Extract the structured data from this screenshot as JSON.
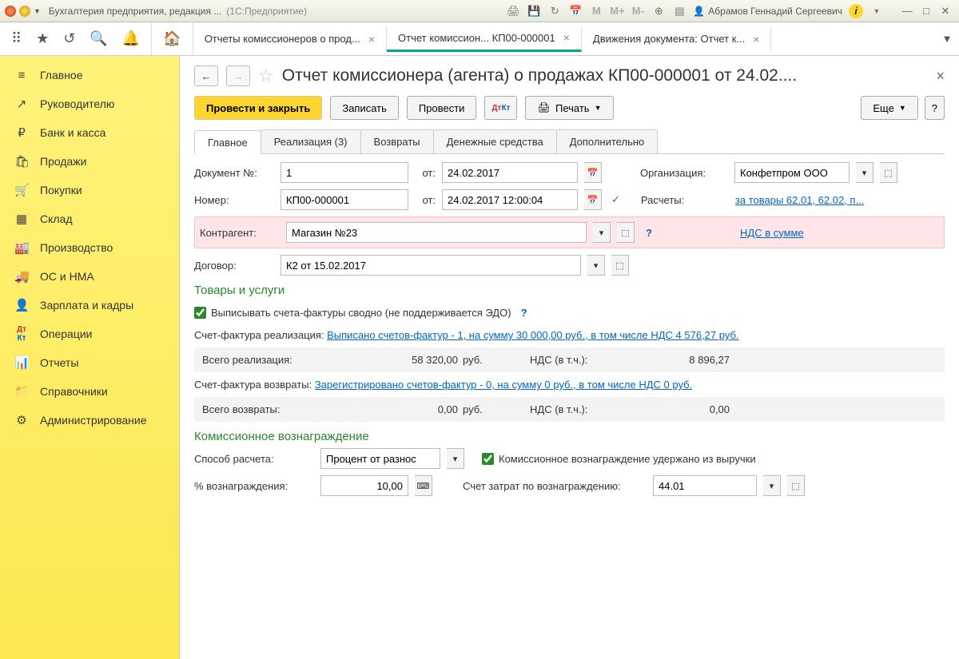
{
  "titlebar": {
    "title": "Бухгалтерия предприятия, редакция ...",
    "subtitle": "(1С:Предприятие)",
    "user": "Абрамов Геннадий Сергеевич",
    "icons": [
      "M",
      "M+",
      "M-"
    ],
    "info_icon": "i"
  },
  "tabs": [
    {
      "label": "Отчеты комиссионеров о прод...",
      "active": false
    },
    {
      "label": "Отчет комиссион... КП00-000001",
      "active": true
    },
    {
      "label": "Движения документа: Отчет к...",
      "active": false
    }
  ],
  "sidebar": [
    {
      "icon": "≡",
      "label": "Главное"
    },
    {
      "icon": "↗",
      "label": "Руководителю"
    },
    {
      "icon": "₽",
      "label": "Банк и касса"
    },
    {
      "icon": "🛍",
      "label": "Продажи"
    },
    {
      "icon": "🛒",
      "label": "Покупки"
    },
    {
      "icon": "▦",
      "label": "Склад"
    },
    {
      "icon": "🏭",
      "label": "Производство"
    },
    {
      "icon": "🚚",
      "label": "ОС и НМА"
    },
    {
      "icon": "👤",
      "label": "Зарплата и кадры"
    },
    {
      "icon": "Дт",
      "label": "Операции"
    },
    {
      "icon": "📊",
      "label": "Отчеты"
    },
    {
      "icon": "📁",
      "label": "Справочники"
    },
    {
      "icon": "⚙",
      "label": "Администрирование"
    }
  ],
  "doc": {
    "title": "Отчет комиссионера (агента) о продажах КП00-000001 от 24.02....",
    "actions": {
      "post_close": "Провести и закрыть",
      "write": "Записать",
      "post": "Провести",
      "print": "Печать",
      "more": "Еще",
      "help": "?"
    },
    "doc_tabs": [
      "Главное",
      "Реализация (3)",
      "Возвраты",
      "Денежные средства",
      "Дополнительно"
    ],
    "fields": {
      "doc_num_label": "Документ №:",
      "doc_num": "1",
      "from1_label": "от:",
      "from1": "24.02.2017",
      "org_label": "Организация:",
      "org": "Конфетпром ООО",
      "number_label": "Номер:",
      "number": "КП00-000001",
      "from2_label": "от:",
      "from2": "24.02.2017 12:00:04",
      "calc_label": "Расчеты:",
      "calc_link": "за товары 62.01, 62.02, п...",
      "partner_label": "Контрагент:",
      "partner": "Магазин №23",
      "nds_link": "НДС в сумме",
      "contract_label": "Договор:",
      "contract": "К2 от 15.02.2017"
    },
    "goods": {
      "title": "Товары и услуги",
      "checkbox_label": "Выписывать счета-фактуры сводно (не поддерживается ЭДО)",
      "sf_real_label": "Счет-фактура реализация:",
      "sf_real_link": "Выписано счетов-фактур - 1, на сумму 30 000,00 руб., в том числе НДС 4 576,27 руб.",
      "total_real_label": "Всего реализация:",
      "total_real": "58 320,00",
      "unit": "руб.",
      "nds_label": "НДС (в т.ч.):",
      "nds_real": "8 896,27",
      "sf_ret_label": "Счет-фактура возвраты:",
      "sf_ret_link": "Зарегистрировано счетов-фактур - 0, на сумму 0 руб., в том числе НДС 0 руб.",
      "total_ret_label": "Всего возвраты:",
      "total_ret": "0,00",
      "nds_ret": "0,00"
    },
    "commission": {
      "title": "Комиссионное вознаграждение",
      "method_label": "Способ расчета:",
      "method": "Процент от разнос",
      "withheld_label": "Комиссионное вознаграждение удержано из выручки",
      "percent_label": "% вознаграждения:",
      "percent": "10,00",
      "cost_account_label": "Счет затрат по вознаграждению:",
      "cost_account": "44.01"
    }
  }
}
